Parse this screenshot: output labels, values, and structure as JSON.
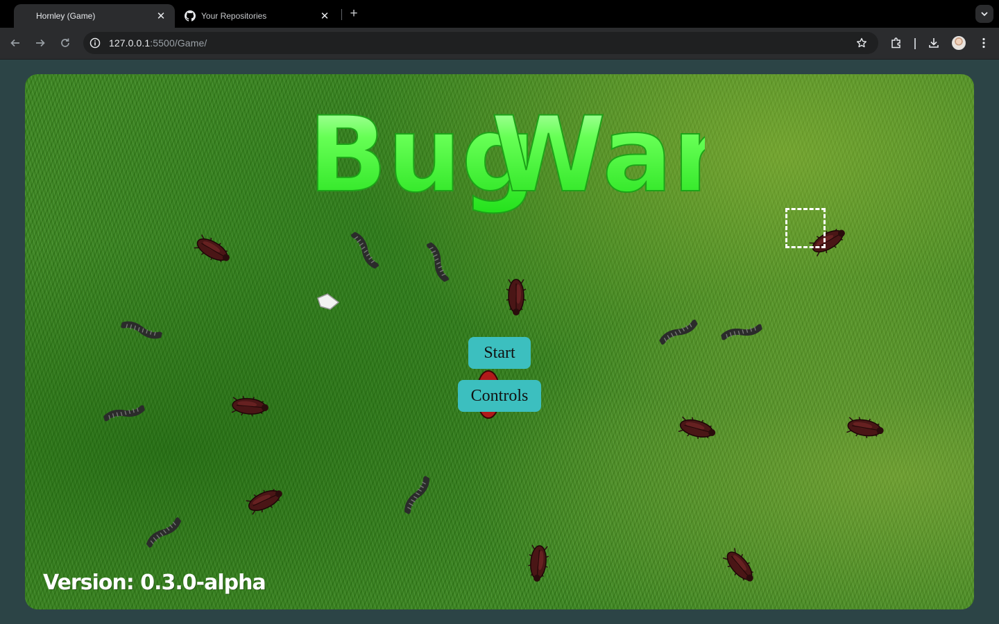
{
  "browser": {
    "tabs": [
      {
        "title": "Hornley (Game)",
        "active": true
      },
      {
        "title": "Your Repositories",
        "active": false,
        "icon": "github-icon"
      }
    ],
    "url_host": "127.0.0.1",
    "url_rest": ":5500/Game/"
  },
  "game": {
    "title": "Bug Wars",
    "title_word1": "Bug",
    "title_word2": "Wars",
    "buttons": {
      "start": "Start",
      "controls": "Controls"
    },
    "version_label": "Version: 0.3.0-alpha",
    "colors": {
      "title_green": "#33ff33",
      "button_teal": "#3cbfbf",
      "grass": "#3a8a1e"
    }
  }
}
